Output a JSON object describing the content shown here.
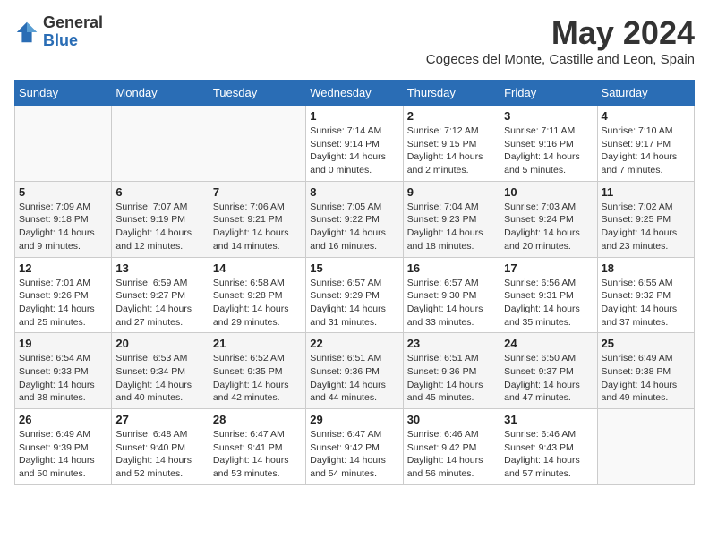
{
  "header": {
    "logo_general": "General",
    "logo_blue": "Blue",
    "month_title": "May 2024",
    "subtitle": "Cogeces del Monte, Castille and Leon, Spain"
  },
  "weekdays": [
    "Sunday",
    "Monday",
    "Tuesday",
    "Wednesday",
    "Thursday",
    "Friday",
    "Saturday"
  ],
  "weeks": [
    [
      {
        "day": "",
        "sunrise": "",
        "sunset": "",
        "daylight": ""
      },
      {
        "day": "",
        "sunrise": "",
        "sunset": "",
        "daylight": ""
      },
      {
        "day": "",
        "sunrise": "",
        "sunset": "",
        "daylight": ""
      },
      {
        "day": "1",
        "sunrise": "Sunrise: 7:14 AM",
        "sunset": "Sunset: 9:14 PM",
        "daylight": "Daylight: 14 hours and 0 minutes."
      },
      {
        "day": "2",
        "sunrise": "Sunrise: 7:12 AM",
        "sunset": "Sunset: 9:15 PM",
        "daylight": "Daylight: 14 hours and 2 minutes."
      },
      {
        "day": "3",
        "sunrise": "Sunrise: 7:11 AM",
        "sunset": "Sunset: 9:16 PM",
        "daylight": "Daylight: 14 hours and 5 minutes."
      },
      {
        "day": "4",
        "sunrise": "Sunrise: 7:10 AM",
        "sunset": "Sunset: 9:17 PM",
        "daylight": "Daylight: 14 hours and 7 minutes."
      }
    ],
    [
      {
        "day": "5",
        "sunrise": "Sunrise: 7:09 AM",
        "sunset": "Sunset: 9:18 PM",
        "daylight": "Daylight: 14 hours and 9 minutes."
      },
      {
        "day": "6",
        "sunrise": "Sunrise: 7:07 AM",
        "sunset": "Sunset: 9:19 PM",
        "daylight": "Daylight: 14 hours and 12 minutes."
      },
      {
        "day": "7",
        "sunrise": "Sunrise: 7:06 AM",
        "sunset": "Sunset: 9:21 PM",
        "daylight": "Daylight: 14 hours and 14 minutes."
      },
      {
        "day": "8",
        "sunrise": "Sunrise: 7:05 AM",
        "sunset": "Sunset: 9:22 PM",
        "daylight": "Daylight: 14 hours and 16 minutes."
      },
      {
        "day": "9",
        "sunrise": "Sunrise: 7:04 AM",
        "sunset": "Sunset: 9:23 PM",
        "daylight": "Daylight: 14 hours and 18 minutes."
      },
      {
        "day": "10",
        "sunrise": "Sunrise: 7:03 AM",
        "sunset": "Sunset: 9:24 PM",
        "daylight": "Daylight: 14 hours and 20 minutes."
      },
      {
        "day": "11",
        "sunrise": "Sunrise: 7:02 AM",
        "sunset": "Sunset: 9:25 PM",
        "daylight": "Daylight: 14 hours and 23 minutes."
      }
    ],
    [
      {
        "day": "12",
        "sunrise": "Sunrise: 7:01 AM",
        "sunset": "Sunset: 9:26 PM",
        "daylight": "Daylight: 14 hours and 25 minutes."
      },
      {
        "day": "13",
        "sunrise": "Sunrise: 6:59 AM",
        "sunset": "Sunset: 9:27 PM",
        "daylight": "Daylight: 14 hours and 27 minutes."
      },
      {
        "day": "14",
        "sunrise": "Sunrise: 6:58 AM",
        "sunset": "Sunset: 9:28 PM",
        "daylight": "Daylight: 14 hours and 29 minutes."
      },
      {
        "day": "15",
        "sunrise": "Sunrise: 6:57 AM",
        "sunset": "Sunset: 9:29 PM",
        "daylight": "Daylight: 14 hours and 31 minutes."
      },
      {
        "day": "16",
        "sunrise": "Sunrise: 6:57 AM",
        "sunset": "Sunset: 9:30 PM",
        "daylight": "Daylight: 14 hours and 33 minutes."
      },
      {
        "day": "17",
        "sunrise": "Sunrise: 6:56 AM",
        "sunset": "Sunset: 9:31 PM",
        "daylight": "Daylight: 14 hours and 35 minutes."
      },
      {
        "day": "18",
        "sunrise": "Sunrise: 6:55 AM",
        "sunset": "Sunset: 9:32 PM",
        "daylight": "Daylight: 14 hours and 37 minutes."
      }
    ],
    [
      {
        "day": "19",
        "sunrise": "Sunrise: 6:54 AM",
        "sunset": "Sunset: 9:33 PM",
        "daylight": "Daylight: 14 hours and 38 minutes."
      },
      {
        "day": "20",
        "sunrise": "Sunrise: 6:53 AM",
        "sunset": "Sunset: 9:34 PM",
        "daylight": "Daylight: 14 hours and 40 minutes."
      },
      {
        "day": "21",
        "sunrise": "Sunrise: 6:52 AM",
        "sunset": "Sunset: 9:35 PM",
        "daylight": "Daylight: 14 hours and 42 minutes."
      },
      {
        "day": "22",
        "sunrise": "Sunrise: 6:51 AM",
        "sunset": "Sunset: 9:36 PM",
        "daylight": "Daylight: 14 hours and 44 minutes."
      },
      {
        "day": "23",
        "sunrise": "Sunrise: 6:51 AM",
        "sunset": "Sunset: 9:36 PM",
        "daylight": "Daylight: 14 hours and 45 minutes."
      },
      {
        "day": "24",
        "sunrise": "Sunrise: 6:50 AM",
        "sunset": "Sunset: 9:37 PM",
        "daylight": "Daylight: 14 hours and 47 minutes."
      },
      {
        "day": "25",
        "sunrise": "Sunrise: 6:49 AM",
        "sunset": "Sunset: 9:38 PM",
        "daylight": "Daylight: 14 hours and 49 minutes."
      }
    ],
    [
      {
        "day": "26",
        "sunrise": "Sunrise: 6:49 AM",
        "sunset": "Sunset: 9:39 PM",
        "daylight": "Daylight: 14 hours and 50 minutes."
      },
      {
        "day": "27",
        "sunrise": "Sunrise: 6:48 AM",
        "sunset": "Sunset: 9:40 PM",
        "daylight": "Daylight: 14 hours and 52 minutes."
      },
      {
        "day": "28",
        "sunrise": "Sunrise: 6:47 AM",
        "sunset": "Sunset: 9:41 PM",
        "daylight": "Daylight: 14 hours and 53 minutes."
      },
      {
        "day": "29",
        "sunrise": "Sunrise: 6:47 AM",
        "sunset": "Sunset: 9:42 PM",
        "daylight": "Daylight: 14 hours and 54 minutes."
      },
      {
        "day": "30",
        "sunrise": "Sunrise: 6:46 AM",
        "sunset": "Sunset: 9:42 PM",
        "daylight": "Daylight: 14 hours and 56 minutes."
      },
      {
        "day": "31",
        "sunrise": "Sunrise: 6:46 AM",
        "sunset": "Sunset: 9:43 PM",
        "daylight": "Daylight: 14 hours and 57 minutes."
      },
      {
        "day": "",
        "sunrise": "",
        "sunset": "",
        "daylight": ""
      }
    ]
  ]
}
